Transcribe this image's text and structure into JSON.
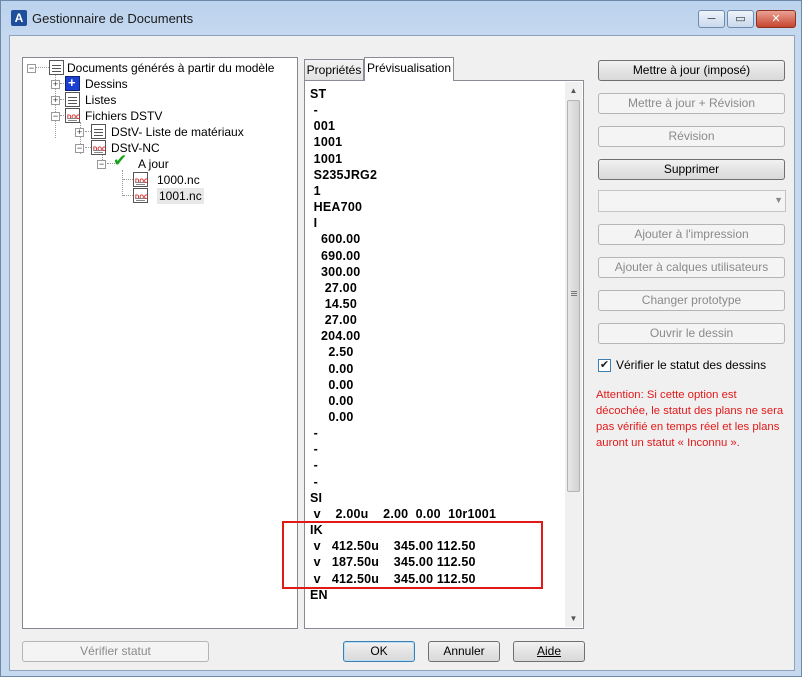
{
  "window": {
    "title": "Gestionnaire de Documents",
    "controls": {
      "minimize": "─",
      "maximize": "▭",
      "close": "✕"
    }
  },
  "tree": {
    "root": "Documents générés à partir du modèle",
    "dessins": "Dessins",
    "listes": "Listes",
    "fichiers_dstv": "Fichiers DSTV",
    "dstv_liste": "DStV- Liste de matériaux",
    "dstv_nc": "DStV-NC",
    "a_jour": "A jour",
    "file1": "1000.nc",
    "file2": "1001.nc"
  },
  "tabs": {
    "proprietes": "Propriétés",
    "previsualisation": "Prévisualisation"
  },
  "preview_lines": [
    "ST",
    " -",
    " 001",
    " 1001",
    " 1001",
    " S235JRG2",
    " 1",
    " HEA700",
    " I",
    "   600.00",
    "   690.00",
    "   300.00",
    "    27.00",
    "    14.50",
    "    27.00",
    "   204.00",
    "     2.50",
    "     0.00",
    "     0.00",
    "     0.00",
    "     0.00",
    " -",
    " -",
    " -",
    " -",
    "SI",
    " v    2.00u    2.00  0.00  10r1001",
    "IK",
    " v   412.50u    345.00 112.50",
    " v   187.50u    345.00 112.50",
    " v   412.50u    345.00 112.50",
    "EN"
  ],
  "actions": {
    "mettre_a_jour_impose": "Mettre à jour (imposé)",
    "mettre_a_jour_revision": "Mettre à jour + Révision",
    "revision": "Révision",
    "supprimer": "Supprimer",
    "ajouter_impression": "Ajouter à l'impression",
    "ajouter_calques": "Ajouter à calques utilisateurs",
    "changer_prototype": "Changer prototype",
    "ouvrir_dessin": "Ouvrir le dessin"
  },
  "combo_value": "",
  "verify_checkbox": {
    "label": "Vérifier le statut des dessins",
    "checked": true
  },
  "warning_text": "Attention: Si cette option est décochée, le statut des plans ne sera pas vérifié en temps réel et les plans auront un statut « Inconnu ».",
  "footer": {
    "verifier_statut": "Vérifier statut",
    "ok": "OK",
    "annuler": "Annuler",
    "aide": "Aide"
  },
  "colors": {
    "warning": "#e11919",
    "highlight_box": "#e11919",
    "window_frame": "#c6d9ef"
  }
}
